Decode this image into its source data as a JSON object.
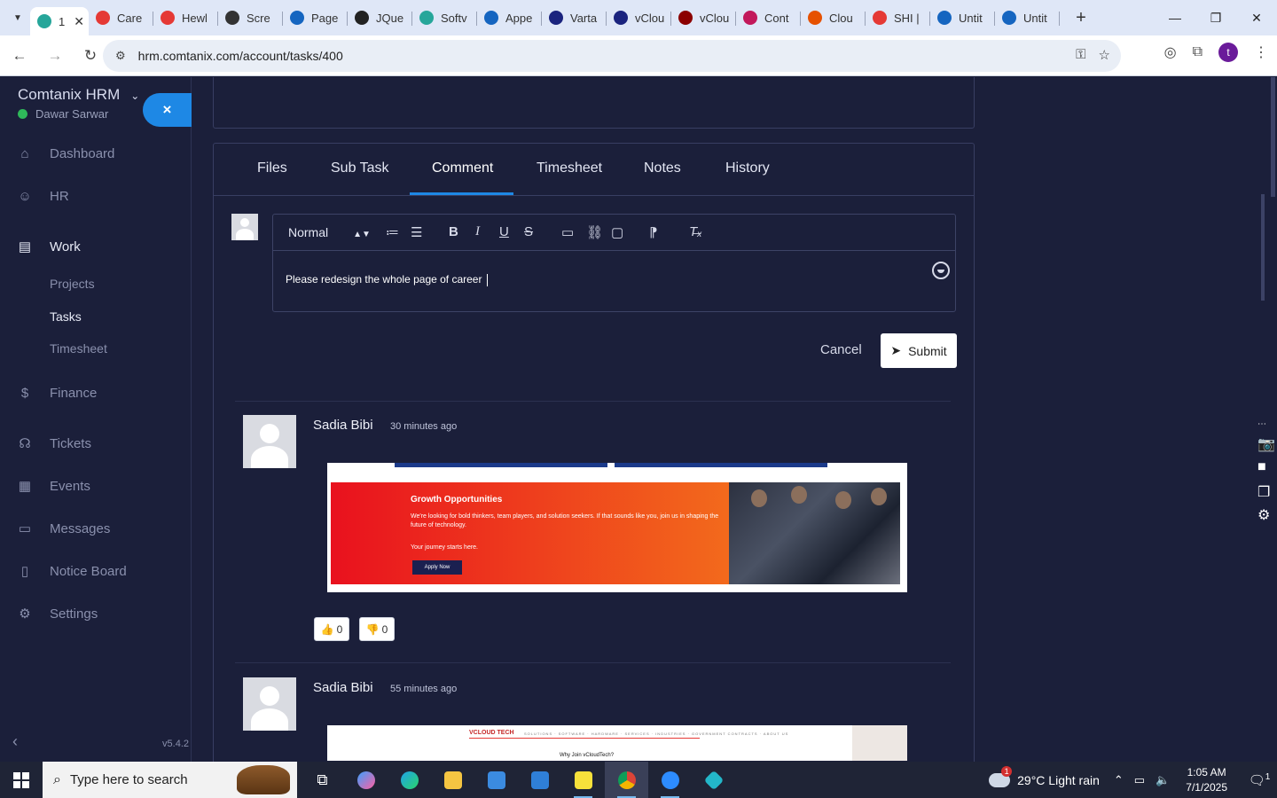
{
  "browser": {
    "tabs": [
      {
        "label": "1",
        "color": "#26a69a",
        "active": true
      },
      {
        "label": "Care",
        "color": "#e53935"
      },
      {
        "label": "Hewl",
        "color": "#e53935"
      },
      {
        "label": "Scre",
        "color": "#333333"
      },
      {
        "label": "Page",
        "color": "#1565c0"
      },
      {
        "label": "JQue",
        "color": "#222222"
      },
      {
        "label": "Softv",
        "color": "#26a69a"
      },
      {
        "label": "Appe",
        "color": "#1565c0"
      },
      {
        "label": "Varta",
        "color": "#1a237e"
      },
      {
        "label": "vClou",
        "color": "#1a237e"
      },
      {
        "label": "vClou",
        "color": "#8b0000"
      },
      {
        "label": "Cont",
        "color": "#c2185b"
      },
      {
        "label": "Clou",
        "color": "#e65100"
      },
      {
        "label": "SHI |",
        "color": "#e53935"
      },
      {
        "label": "Untit",
        "color": "#1565c0"
      },
      {
        "label": "Untit",
        "color": "#1565c0"
      }
    ],
    "url": "hrm.comtanix.com/account/tasks/400",
    "profile_initial": "t"
  },
  "sidebar": {
    "brand": "Comtanix HRM",
    "user": "Dawar Sarwar",
    "close_icon": "×",
    "items": [
      {
        "label": "Dashboard",
        "icon": "⌂"
      },
      {
        "label": "HR",
        "icon": "☺"
      },
      {
        "label": "Work",
        "icon": "▤"
      },
      {
        "label": "Finance",
        "icon": "$"
      },
      {
        "label": "Tickets",
        "icon": "☊"
      },
      {
        "label": "Events",
        "icon": "▦"
      },
      {
        "label": "Messages",
        "icon": "▭"
      },
      {
        "label": "Notice Board",
        "icon": "▯"
      },
      {
        "label": "Settings",
        "icon": "⚙"
      }
    ],
    "sub_items": [
      "Projects",
      "Tasks",
      "Timesheet"
    ],
    "version": "v5.4.2"
  },
  "tabs": [
    "Files",
    "Sub Task",
    "Comment",
    "Timesheet",
    "Notes",
    "History"
  ],
  "active_tab": "Comment",
  "editor": {
    "format": "Normal",
    "text": "Please redesign the whole page of career "
  },
  "actions": {
    "cancel": "Cancel",
    "submit": "Submit"
  },
  "comments": [
    {
      "author": "Sadia Bibi",
      "time": "30 minutes ago",
      "banner": {
        "title": "Growth Opportunities",
        "text": "We're looking for bold thinkers, team players, and solution seekers. If that sounds like you, join us in shaping the future of technology.",
        "sub": "Your journey starts here.",
        "button": "Apply Now"
      },
      "likes": "0",
      "dislikes": "0"
    },
    {
      "author": "Sadia Bibi",
      "time": "55 minutes ago",
      "image": {
        "logo": "VCLOUD TECH",
        "menu": "SOLUTIONS · SOFTWARE · HARDWARE · SERVICES · INDUSTRIES · GOVERNMENT CONTRACTS · ABOUT US",
        "heading": "Why Join vCloudTech?"
      }
    }
  ],
  "taskbar": {
    "search_placeholder": "Type here to search",
    "weather": "29°C  Light rain",
    "time": "1:05 AM",
    "date": "7/1/2025",
    "weather_badge": "1",
    "notif_count": "1"
  }
}
